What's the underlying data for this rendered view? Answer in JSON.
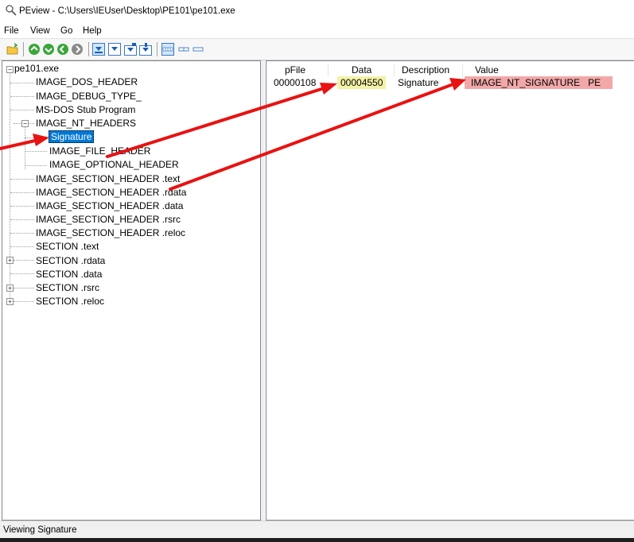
{
  "window": {
    "title": "PEview - C:\\Users\\IEUser\\Desktop\\PE101\\pe101.exe"
  },
  "menu": [
    "File",
    "View",
    "Go",
    "Help"
  ],
  "toolbar_icons": [
    "open-file-icon",
    "go-back-icon",
    "go-forward-icon",
    "go-previous-icon",
    "go-next-icon",
    "view-hex-icon",
    "view-pfile-icon",
    "view-rva-icon",
    "view-va-icon",
    "view-byte-icon",
    "view-word-icon",
    "view-dword-icon"
  ],
  "tree": {
    "root": "pe101.exe",
    "items": [
      "IMAGE_DOS_HEADER",
      "IMAGE_DEBUG_TYPE_",
      "MS-DOS Stub Program",
      "IMAGE_NT_HEADERS",
      "Signature",
      "IMAGE_FILE_HEADER",
      "IMAGE_OPTIONAL_HEADER",
      "IMAGE_SECTION_HEADER .text",
      "IMAGE_SECTION_HEADER .rdata",
      "IMAGE_SECTION_HEADER .data",
      "IMAGE_SECTION_HEADER .rsrc",
      "IMAGE_SECTION_HEADER .reloc",
      "SECTION .text",
      "SECTION .rdata",
      "SECTION .data",
      "SECTION .rsrc",
      "SECTION .reloc"
    ],
    "selected": "Signature"
  },
  "table": {
    "columns": [
      "pFile",
      "Data",
      "Description",
      "Value"
    ],
    "rows": [
      {
        "pfile": "00000108",
        "data": "00004550",
        "description": "Signature",
        "value": "IMAGE_NT_SIGNATURE   PE"
      }
    ]
  },
  "colors": {
    "selection": "#0078d7",
    "data_highlight": "#f4f2a6",
    "value_highlight": "#f2a8a8",
    "arrow": "#e81212"
  },
  "status": "Viewing Signature"
}
